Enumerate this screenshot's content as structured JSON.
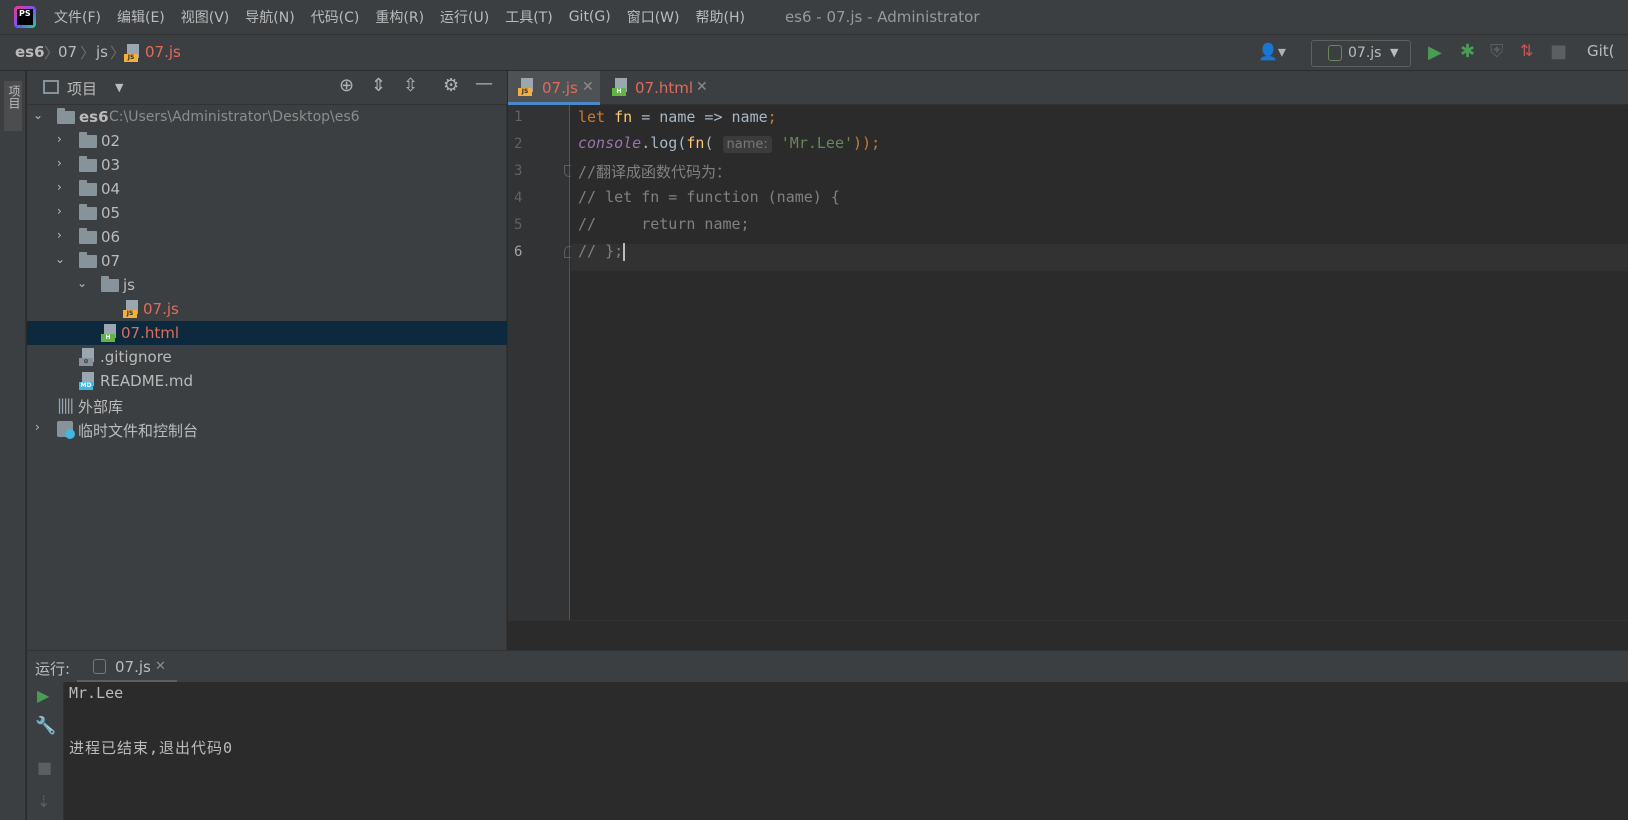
{
  "window": {
    "title": "es6 - 07.js - Administrator"
  },
  "app_icon": "phpstorm-logo",
  "menu": [
    "文件(F)",
    "编辑(E)",
    "视图(V)",
    "导航(N)",
    "代码(C)",
    "重构(R)",
    "运行(U)",
    "工具(T)",
    "Git(G)",
    "窗口(W)",
    "帮助(H)"
  ],
  "breadcrumb": [
    "es6",
    "07",
    "js",
    "07.js"
  ],
  "toolbar": {
    "run_config": "07.js",
    "git_label": "Git("
  },
  "left_stripe": {
    "project_label": "项目"
  },
  "project_panel": {
    "title": "项目",
    "tree": {
      "root_name": "es6",
      "root_path": "C:\\Users\\Administrator\\Desktop\\es6",
      "folders": [
        "02",
        "03",
        "04",
        "05",
        "06"
      ],
      "folder_07": "07",
      "folder_js": "js",
      "file_07js": "07.js",
      "file_07html": "07.html",
      "gitignore": ".gitignore",
      "readme": "README.md",
      "external_libs": "外部库",
      "scratches": "临时文件和控制台"
    }
  },
  "editor": {
    "tabs": [
      {
        "label": "07.js",
        "active": true
      },
      {
        "label": "07.html",
        "active": false
      }
    ],
    "line_numbers": [
      "1",
      "2",
      "3",
      "4",
      "5",
      "6"
    ],
    "lines": {
      "l1_kw": "let",
      "l1_name": "fn",
      "l1_rest": " = name => name",
      "l1_semi": ";",
      "l2_console": "console",
      "l2_dot_log": ".log(",
      "l2_fn": "fn",
      "l2_paren": "(",
      "l2_hint": "name:",
      "l2_str": "'Mr.Lee'",
      "l2_close": "));",
      "l3": "//翻译成函数代码为：",
      "l4": "// let fn = function (name) {",
      "l5": "//     return name;",
      "l6": "// };"
    }
  },
  "run_panel": {
    "label": "运行:",
    "tab": "07.js",
    "output": [
      "Mr.Lee",
      "进程已结束,退出代码0"
    ]
  },
  "colors": {
    "accent": "#4a88c7",
    "file_red": "#e06c5b",
    "run_green": "#499c54",
    "selection": "#0d293e"
  }
}
